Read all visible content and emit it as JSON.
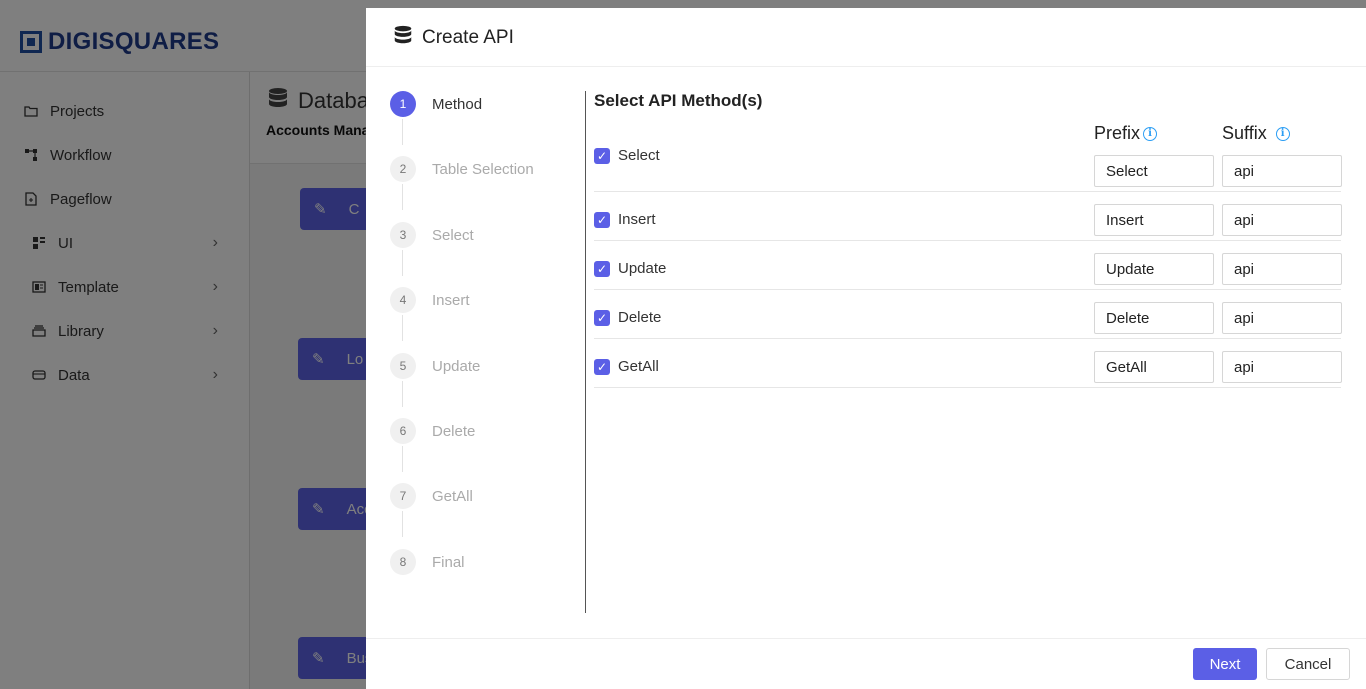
{
  "app": {
    "logo": "DIGISQUARES",
    "nav": [
      {
        "label": "Projects",
        "icon": "folder-icon"
      },
      {
        "label": "Workflow",
        "icon": "workflow-icon"
      },
      {
        "label": "Pageflow",
        "icon": "pageflow-icon"
      },
      {
        "label": "UI",
        "icon": "ui-icon"
      },
      {
        "label": "Template",
        "icon": "template-icon"
      },
      {
        "label": "Library",
        "icon": "library-icon"
      },
      {
        "label": "Data",
        "icon": "data-icon"
      }
    ],
    "content_title": "Databa",
    "content_subtitle": "Accounts Mana",
    "bg_cards": [
      "C",
      "Lo",
      "Acc",
      "Bus"
    ]
  },
  "drawer": {
    "title": "Create API",
    "steps": [
      {
        "num": "1",
        "label": "Method"
      },
      {
        "num": "2",
        "label": "Table Selection"
      },
      {
        "num": "3",
        "label": "Select"
      },
      {
        "num": "4",
        "label": "Insert"
      },
      {
        "num": "5",
        "label": "Update"
      },
      {
        "num": "6",
        "label": "Delete"
      },
      {
        "num": "7",
        "label": "GetAll"
      },
      {
        "num": "8",
        "label": "Final"
      }
    ],
    "panel_title": "Select API Method(s)",
    "prefix_label": "Prefix",
    "suffix_label": "Suffix",
    "methods": [
      {
        "label": "Select",
        "prefix": "Select",
        "suffix": "api",
        "checked": true
      },
      {
        "label": "Insert",
        "prefix": "Insert",
        "suffix": "api",
        "checked": true
      },
      {
        "label": "Update",
        "prefix": "Update",
        "suffix": "api",
        "checked": true
      },
      {
        "label": "Delete",
        "prefix": "Delete",
        "suffix": "api",
        "checked": true
      },
      {
        "label": "GetAll",
        "prefix": "GetAll",
        "suffix": "api",
        "checked": true
      }
    ],
    "next_label": "Next",
    "cancel_label": "Cancel"
  },
  "colors": {
    "accent": "#5b5fe6",
    "info": "#2a9df4",
    "logo": "#1e3a8a"
  }
}
